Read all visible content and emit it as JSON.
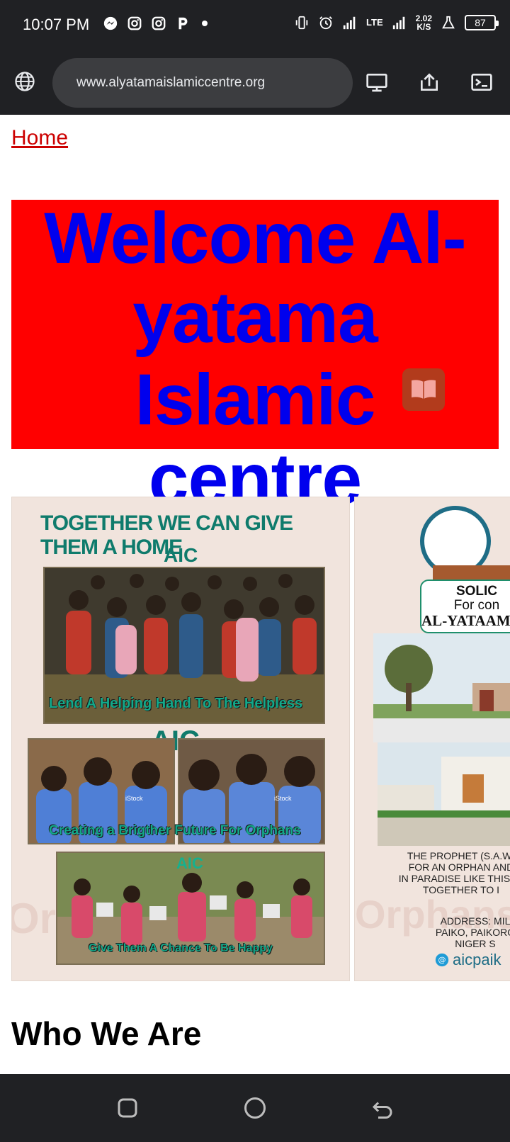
{
  "status_bar": {
    "time": "10:07 PM",
    "left_icons": [
      "messenger-icon",
      "instagram-icon",
      "instagram-icon",
      "parking-app-icon"
    ],
    "network": "LTE",
    "speed_value": "2.02",
    "speed_unit": "K/S",
    "battery": "87"
  },
  "browser": {
    "url": "www.alyatamaislamiccentre.org",
    "icons": [
      "globe-icon",
      "desktop-icon",
      "share-icon",
      "console-icon"
    ]
  },
  "page": {
    "home_link": "Home",
    "welcome_lines": [
      "Welcome Al-",
      "yatama Islamic",
      "centre"
    ],
    "slide1": {
      "headline": "TOGETHER WE CAN GIVE THEM A HOME",
      "aic_1": "AIC",
      "caption_1": "Lend A Helping Hand To The Helpless",
      "aic_2": "AIC",
      "caption_2": "Creating  a Brigther Future For Orphans",
      "aic_3": "AIC",
      "caption_3": "Give Them A Chance To Be Happy",
      "istock_1": "iStock",
      "istock_2": "iStock"
    },
    "slide2": {
      "solic": "SOLIC",
      "for_con": "For con",
      "alyataamaa": "AL-YATAAMAA",
      "text_lines": [
        "THE PROPHET (S.A.W)",
        "FOR AN ORPHAN AND",
        "IN PARADISE LIKE THIS', A",
        "TOGETHER TO I"
      ],
      "address_lines": [
        "ADDRESS: MIL",
        "PAIKO, PAIKORO",
        "NIGER S"
      ],
      "url_text": "aicpaik"
    },
    "who_we_are": "Who We Are"
  },
  "colors": {
    "welcome_bg": "#ff0000",
    "welcome_text": "#0000ee",
    "home_link": "#cc0000",
    "system_bar": "#202124",
    "slide_teal": "#0f7b6c"
  }
}
